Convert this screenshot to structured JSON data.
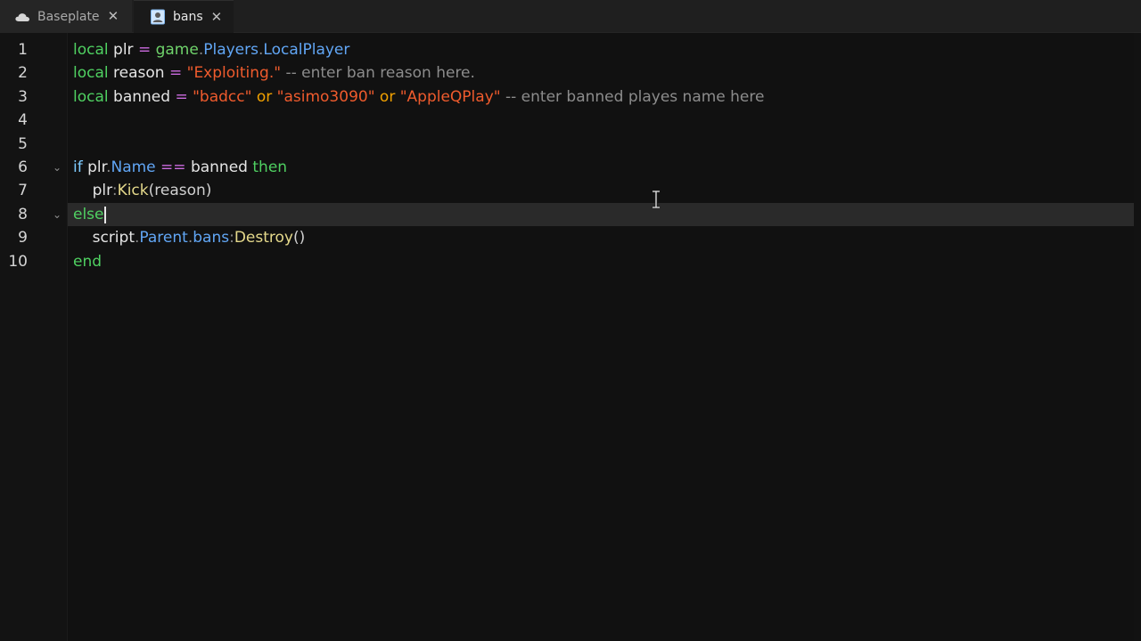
{
  "tabs": [
    {
      "label": "Baseplate",
      "icon": "cloud-icon",
      "close": "✕"
    },
    {
      "label": "bans",
      "icon": "script-icon",
      "close": "✕"
    }
  ],
  "editor": {
    "line_numbers": [
      "1",
      "2",
      "3",
      "4",
      "5",
      "6",
      "7",
      "8",
      "9",
      "10"
    ],
    "lines": [
      [
        {
          "t": "local",
          "c": "local"
        },
        {
          "t": " plr ",
          "c": "var"
        },
        {
          "t": "=",
          "c": "op"
        },
        {
          "t": " game",
          "c": "game"
        },
        {
          "t": ".",
          "c": "dot"
        },
        {
          "t": "Players",
          "c": "prop"
        },
        {
          "t": ".",
          "c": "dot"
        },
        {
          "t": "LocalPlayer",
          "c": "prop"
        }
      ],
      [
        {
          "t": "local",
          "c": "local"
        },
        {
          "t": " reason ",
          "c": "var"
        },
        {
          "t": "=",
          "c": "op"
        },
        {
          "t": " \"Exploiting.\"",
          "c": "str"
        },
        {
          "t": " -- enter ban reason here.",
          "c": "comment"
        }
      ],
      [
        {
          "t": "local",
          "c": "local"
        },
        {
          "t": " banned ",
          "c": "var"
        },
        {
          "t": "=",
          "c": "op"
        },
        {
          "t": " \"badcc\"",
          "c": "str"
        },
        {
          "t": " or",
          "c": "or"
        },
        {
          "t": " \"asimo3090\"",
          "c": "str"
        },
        {
          "t": " or",
          "c": "or"
        },
        {
          "t": " \"AppleQPlay\"",
          "c": "str"
        },
        {
          "t": " -- enter banned playes name here",
          "c": "comment"
        }
      ],
      [],
      [],
      [
        {
          "t": "if",
          "c": "if"
        },
        {
          "t": " plr",
          "c": "var"
        },
        {
          "t": ".",
          "c": "dot"
        },
        {
          "t": "Name",
          "c": "prop"
        },
        {
          "t": " ==",
          "c": "op"
        },
        {
          "t": " banned",
          "c": "var"
        },
        {
          "t": " then",
          "c": "then"
        }
      ],
      [
        {
          "t": "    plr",
          "c": "var"
        },
        {
          "t": ":",
          "c": "dot"
        },
        {
          "t": "Kick",
          "c": "func"
        },
        {
          "t": "(reason)",
          "c": "paren"
        }
      ],
      [
        {
          "t": "else",
          "c": "else"
        }
      ],
      [
        {
          "t": "    script",
          "c": "var"
        },
        {
          "t": ".",
          "c": "dot"
        },
        {
          "t": "Parent",
          "c": "prop"
        },
        {
          "t": ".",
          "c": "dot"
        },
        {
          "t": "bans",
          "c": "prop"
        },
        {
          "t": ":",
          "c": "dot"
        },
        {
          "t": "Destroy",
          "c": "func"
        },
        {
          "t": "()",
          "c": "paren"
        }
      ],
      [
        {
          "t": "end",
          "c": "end"
        }
      ]
    ],
    "fold_markers": [
      {
        "line": 6,
        "glyph": "⌄"
      },
      {
        "line": 8,
        "glyph": "⌄"
      }
    ]
  }
}
